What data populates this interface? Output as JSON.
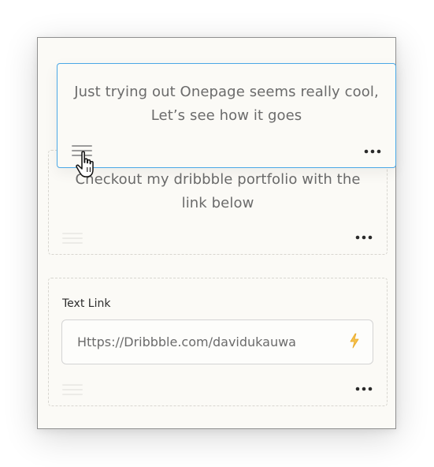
{
  "blocks": [
    {
      "type": "text",
      "text": "Checkout my dribbble portfolio with the link below"
    },
    {
      "type": "link",
      "label": "Text Link",
      "value": "Https://Dribbble.com/davidukauwa"
    }
  ],
  "dragging_block": {
    "type": "text",
    "text": "Just trying out Onepage seems really cool, Let’s see how it goes"
  },
  "icons": {
    "drag_handle": "drag-handle-icon",
    "more": "more-dots-icon",
    "bolt": "lightning-bolt-icon",
    "cursor": "hand-cursor-icon"
  },
  "colors": {
    "selection_border": "#4aa8e6",
    "bolt": "#f2b233",
    "panel_bg": "#fbfaf6"
  }
}
